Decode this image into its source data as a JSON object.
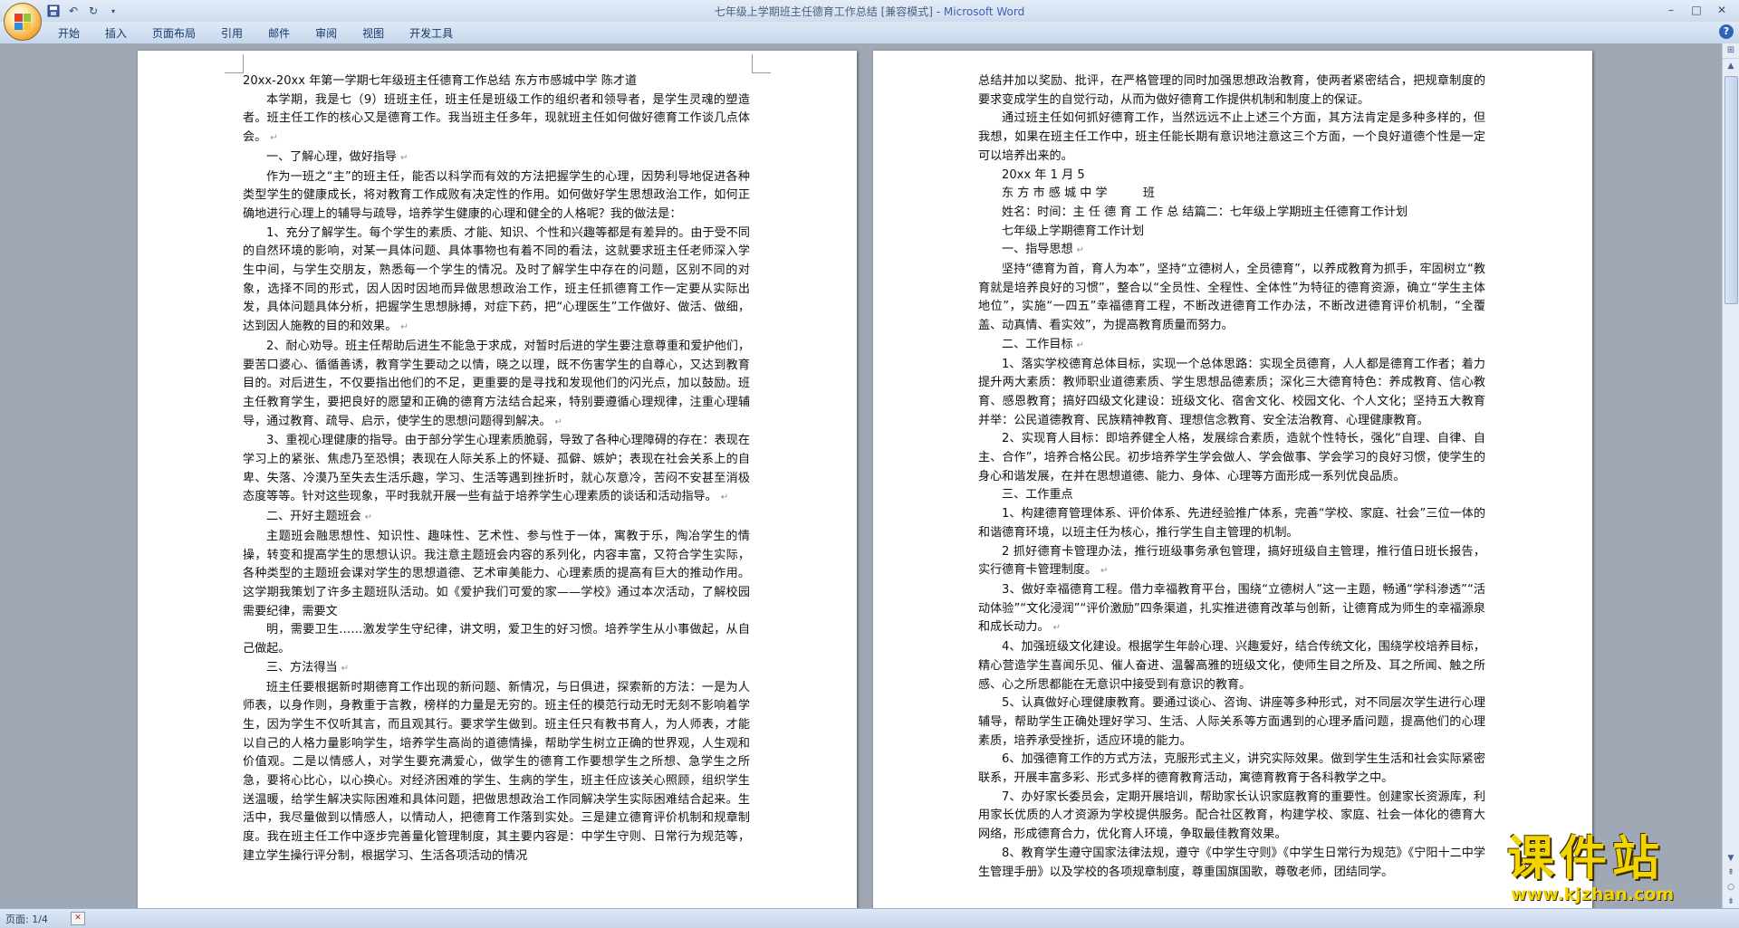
{
  "window": {
    "title_doc": "七年级上学期班主任德育工作总结 [兼容模式] - ",
    "title_app": "Microsoft Word",
    "controls": [
      "–",
      "□",
      "✕"
    ]
  },
  "quick_access": {
    "save_icon": "save-icon",
    "undo_icon": "undo-icon",
    "redo_icon": "redo-icon",
    "customize_icon": "dropdown-icon"
  },
  "ribbon": {
    "tabs": [
      "开始",
      "插入",
      "页面布局",
      "引用",
      "邮件",
      "审阅",
      "视图",
      "开发工具"
    ],
    "help": "?"
  },
  "pages": [
    {
      "paragraphs": [
        {
          "text": "20xx-20xx 年第一学期七年级班主任德育工作总结 东方市感城中学 陈才道",
          "indent": false,
          "mark": false
        },
        {
          "text": "本学期，我是七（9）班班主任，班主任是班级工作的组织者和领导者，是学生灵魂的塑造者。班主任工作的核心又是德育工作。我当班主任多年，现就班主任如何做好德育工作谈几点体会。",
          "indent": true,
          "mark": true
        },
        {
          "text": "一、了解心理，做好指导",
          "indent": true,
          "mark": true
        },
        {
          "text": "作为一班之“主”的班主任，能否以科学而有效的方法把握学生的心理，因势利导地促进各种类型学生的健康成长，将对教育工作成败有决定性的作用。如何做好学生思想政治工作，如何正确地进行心理上的辅导与疏导，培养学生健康的心理和健全的人格呢？我的做法是：",
          "indent": true,
          "mark": false
        },
        {
          "text": "1、充分了解学生。每个学生的素质、才能、知识、个性和兴趣等都是有差异的。由于受不同的自然环境的影响，对某一具体问题、具体事物也有着不同的看法，这就要求班主任老师深入学生中间，与学生交朋友，熟悉每一个学生的情况。及时了解学生中存在的问题，区别不同的对象，选择不同的形式，因人因时因地而异做思想政治工作，班主任抓德育工作一定要从实际出发，具体问题具体分析，把握学生思想脉搏，对症下药，把“心理医生”工作做好、做活、做细，达到因人施教的目的和效果。",
          "indent": true,
          "mark": true
        },
        {
          "text": "2、耐心劝导。班主任帮助后进生不能急于求成，对暂时后进的学生要注意尊重和爱护他们，要苦口婆心、循循善诱，教育学生要动之以情，晓之以理，既不伤害学生的自尊心，又达到教育目的。对后进生，不仅要指出他们的不足，更重要的是寻找和发现他们的闪光点，加以鼓励。班主任教育学生，要把良好的愿望和正确的德育方法结合起来，特别要遵循心理规律，注重心理辅导，通过教育、疏导、启示，使学生的思想问题得到解决。",
          "indent": true,
          "mark": true
        },
        {
          "text": "3、重视心理健康的指导。由于部分学生心理素质脆弱，导致了各种心理障碍的存在：表现在学习上的紧张、焦虑乃至恐惧；表现在人际关系上的怀疑、孤僻、嫉妒；表现在社会关系上的自卑、失落、冷漠乃至失去生活乐趣，学习、生活等遇到挫折时，就心灰意冷，苦闷不安甚至消极态度等等。针对这些现象，平时我就开展一些有益于培养学生心理素质的谈话和活动指导。",
          "indent": true,
          "mark": true
        },
        {
          "text": "二、开好主题班会",
          "indent": true,
          "mark": true
        },
        {
          "text": "主题班会融思想性、知识性、趣味性、艺术性、参与性于一体，寓教于乐，陶冶学生的情操，转变和提高学生的思想认识。我注意主题班会内容的系列化，内容丰富，又符合学生实际，各种类型的主题班会课对学生的思想道德、艺术审美能力、心理素质的提高有巨大的推动作用。这学期我策划了许多主题班队活动。如《爱护我们可爱的家——学校》通过本次活动，了解校园需要纪律，需要文",
          "indent": true,
          "mark": false
        },
        {
          "text": "明，需要卫生……激发学生守纪律，讲文明，爱卫生的好习惯。培养学生从小事做起，从自己做起。",
          "indent": true,
          "mark": false
        },
        {
          "text": "三、方法得当",
          "indent": true,
          "mark": true
        },
        {
          "text": "班主任要根据新时期德育工作出现的新问题、新情况，与日俱进，探索新的方法：一是为人师表，以身作则，身教重于言教，榜样的力量是无穷的。班主任的模范行动无时无刻不影响着学生，因为学生不仅听其言，而且观其行。要求学生做到。班主任只有教书育人，为人师表，才能以自己的人格力量影响学生，培养学生高尚的道德情操，帮助学生树立正确的世界观，人生观和价值观。二是以情感人，对学生要充满爱心，做学生的德育工作要想学生之所想、急学生之所急，要将心比心，以心换心。对经济困难的学生、生病的学生，班主任应该关心照顾，组织学生送温暖，给学生解决实际困难和具体问题，把做思想政治工作同解决学生实际困难结合起来。生活中，我尽量做到以情感人，以情动人，把德育工作落到实处。三是建立德育评价机制和规章制度。我在班主任工作中逐步完善量化管理制度，其主要内容是：中学生守则、日常行为规范等，建立学生操行评分制，根据学习、生活各项活动的情况",
          "indent": true,
          "mark": false
        }
      ]
    },
    {
      "paragraphs": [
        {
          "text": "总结并加以奖励、批评，在严格管理的同时加强思想政治教育，使两者紧密结合，把规章制度的要求变成学生的自觉行动，从而为做好德育工作提供机制和制度上的保证。",
          "indent": false,
          "mark": false
        },
        {
          "text": "通过班主任如何抓好德育工作，当然远远不止上述三个方面，其方法肯定是多种多样的，但我想，如果在班主任工作中，班主任能长期有意识地注意这三个方面，一个良好道德个性是一定可以培养出来的。",
          "indent": true,
          "mark": false
        },
        {
          "text": "20xx 年 1 月 5",
          "indent": true,
          "mark": false
        },
        {
          "text": "东 方 市 感 城 中 学　　　班",
          "indent": true,
          "mark": false
        },
        {
          "text": "姓名：时间：主 任 德 育 工 作 总 结篇二：七年级上学期班主任德育工作计划",
          "indent": true,
          "mark": false
        },
        {
          "text": "七年级上学期德育工作计划",
          "indent": true,
          "mark": false
        },
        {
          "text": "一、指导思想",
          "indent": true,
          "mark": true
        },
        {
          "text": "坚持“德育为首，育人为本”，坚持“立德树人，全员德育”，以养成教育为抓手，牢固树立“教育就是培养良好的习惯”，整合以“全员性、全程性、全体性”为特征的德育资源，确立“学生主体地位”，实施“一四五”幸福德育工程，不断改进德育工作办法，不断改进德育评价机制，“全覆盖、动真情、看实效”，为提高教育质量而努力。",
          "indent": true,
          "mark": false
        },
        {
          "text": "二、工作目标",
          "indent": true,
          "mark": true
        },
        {
          "text": "1、落实学校德育总体目标，实现一个总体思路：实现全员德育，人人都是德育工作者；着力提升两大素质：教师职业道德素质、学生思想品德素质；深化三大德育特色：养成教育、信心教育、感恩教育；搞好四级文化建设：班级文化、宿舍文化、校园文化、个人文化；坚持五大教育并举：公民道德教育、民族精神教育、理想信念教育、安全法治教育、心理健康教育。",
          "indent": true,
          "mark": false
        },
        {
          "text": "2、实现育人目标：即培养健全人格，发展综合素质，造就个性特长，强化“自理、自律、自主、合作”，培养合格公民。初步培养学生学会做人、学会做事、学会学习的良好习惯，使学生的身心和谐发展，在并在思想道德、能力、身体、心理等方面形成一系列优良品质。",
          "indent": true,
          "mark": false
        },
        {
          "text": "三、工作重点",
          "indent": true,
          "mark": false
        },
        {
          "text": "1、构建德育管理体系、评价体系、先进经验推广体系，完善“学校、家庭、社会”三位一体的和谐德育环境，以班主任为核心，推行学生自主管理的机制。",
          "indent": true,
          "mark": false
        },
        {
          "text": "2 抓好德育卡管理办法，推行班级事务承包管理，搞好班级自主管理，推行值日班长报告，实行德育卡管理制度。",
          "indent": true,
          "mark": true
        },
        {
          "text": "3、做好幸福德育工程。借力幸福教育平台，围绕“立德树人”这一主题，畅通“学科渗透”“活动体验”“文化浸润”“评价激励”四条渠道，扎实推进德育改革与创新，让德育成为师生的幸福源泉和成长动力。",
          "indent": true,
          "mark": true
        },
        {
          "text": "4、加强班级文化建设。根据学生年龄心理、兴趣爱好，结合传统文化，围绕学校培养目标，精心营造学生喜闻乐见、催人奋进、温馨高雅的班级文化，使师生目之所及、耳之所闻、触之所感、心之所思都能在无意识中接受到有意识的教育。",
          "indent": true,
          "mark": false
        },
        {
          "text": "5、认真做好心理健康教育。要通过谈心、咨询、讲座等多种形式，对不同层次学生进行心理辅导，帮助学生正确处理好学习、生活、人际关系等方面遇到的心理矛盾问题，提高他们的心理素质，培养承受挫折，适应环境的能力。",
          "indent": true,
          "mark": false
        },
        {
          "text": "6、加强德育工作的方式方法，克服形式主义，讲究实际效果。做到学生生活和社会实际紧密联系，开展丰富多彩、形式多样的德育教育活动，寓德育教育于各科教学之中。",
          "indent": true,
          "mark": false
        },
        {
          "text": "7、办好家长委员会，定期开展培训，帮助家长认识家庭教育的重要性。创建家长资源库，利用家长优质的人才资源为学校提供服务。配合社区教育，构建学校、家庭、社会一体化的德育大网络，形成德育合力，优化育人环境，争取最佳教育效果。",
          "indent": true,
          "mark": false
        },
        {
          "text": "8、教育学生遵守国家法律法规，遵守《中学生守则》《中学生日常行为规范》《宁阳十二中学生管理手册》以及学校的各项规章制度，尊重国旗国歌，尊敬老师，团结同学。",
          "indent": true,
          "mark": false
        }
      ]
    }
  ],
  "status_bar": {
    "page_info": "页面: 1/4",
    "proofing_icon": "spelling-check-icon"
  },
  "watermark": {
    "text": "课件站",
    "url": "www.kjzhan.com"
  },
  "colors": {
    "title_brand": "#3c64b4",
    "watermark": "#f2d400",
    "workspace": "#9fa8b4"
  }
}
